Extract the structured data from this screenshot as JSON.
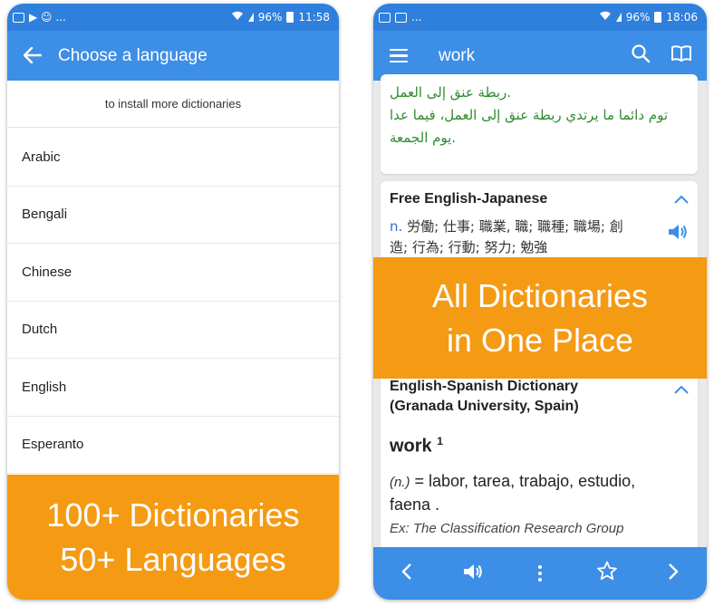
{
  "left": {
    "status": {
      "left_icons": "▶ ☺ ...",
      "battery": "96%",
      "time": "11:58"
    },
    "appbar": {
      "title": "Choose a language"
    },
    "install_note": "to install more dictionaries",
    "languages": [
      "Arabic",
      "Bengali",
      "Chinese",
      "Dutch",
      "English",
      "Esperanto"
    ],
    "promo": {
      "line1": "100+ Dictionaries",
      "line2": "50+ Languages"
    }
  },
  "right": {
    "status": {
      "left_icons": "...",
      "battery": "96%",
      "time": "18:06"
    },
    "appbar": {
      "title": "work"
    },
    "arabic": {
      "line1": ".ربطة عنق إلى العمل",
      "line2": "توم دائما ما يرتدي ربطة عنق إلى العمل، فيما عدا",
      "line3": ".يوم الجمعة"
    },
    "jp_card": {
      "title": "Free English-Japanese",
      "pos": "n.",
      "line1": "労働; 仕事; 職業, 職; 職種; 職場; 創",
      "line2": "造; 行為; 行動; 努力; 勉強"
    },
    "promo": {
      "line1": "All Dictionaries",
      "line2": "in One Place"
    },
    "es_card": {
      "title_line1": "English-Spanish Dictionary",
      "title_line2": "(Granada University, Spain)",
      "headword": "work",
      "sup": "1",
      "pos": "(n.)",
      "def": " = labor, tarea, trabajo, estudio,",
      "def2": "faena .",
      "ex_label": "Ex:",
      "ex_text": " The Classification Research Group"
    }
  },
  "colors": {
    "primary": "#3d8ee6",
    "status": "#2f7fdc",
    "promo": "#f59a13",
    "arabic": "#2e8b2e"
  }
}
